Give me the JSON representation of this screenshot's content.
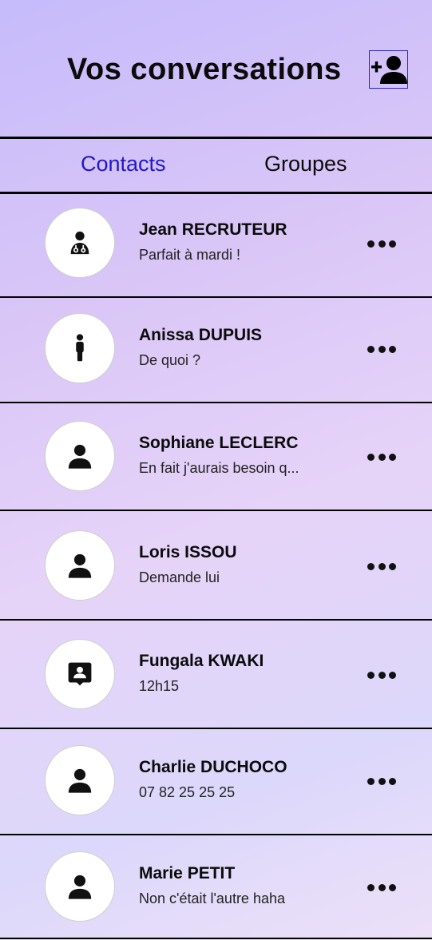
{
  "header": {
    "title": "Vos conversations",
    "add_contact_icon": "person-add-icon"
  },
  "tabs": [
    {
      "label": "Contacts",
      "active": true,
      "color": "#2218c8"
    },
    {
      "label": "Groupes",
      "active": false,
      "color": "#0b0b0b"
    }
  ],
  "conversations": [
    {
      "name": "Jean RECRUTEUR",
      "message": "Parfait à mardi !",
      "icon": "doctor-icon"
    },
    {
      "name": "Anissa DUPUIS",
      "message": "De quoi ?",
      "icon": "standing-person-icon"
    },
    {
      "name": "Sophiane LECLERC",
      "message": "En fait j'aurais besoin q...",
      "icon": "person-icon"
    },
    {
      "name": "Loris ISSOU",
      "message": "Demande lui",
      "icon": "person-icon"
    },
    {
      "name": "Fungala KWAKI",
      "message": "12h15",
      "icon": "contact-card-icon"
    },
    {
      "name": "Charlie DUCHOCO",
      "message": "07 82 25 25 25",
      "icon": "person-icon"
    },
    {
      "name": "Marie PETIT",
      "message": "Non c'était l'autre haha",
      "icon": "person-icon"
    }
  ],
  "more_icon": "more-dots-icon"
}
